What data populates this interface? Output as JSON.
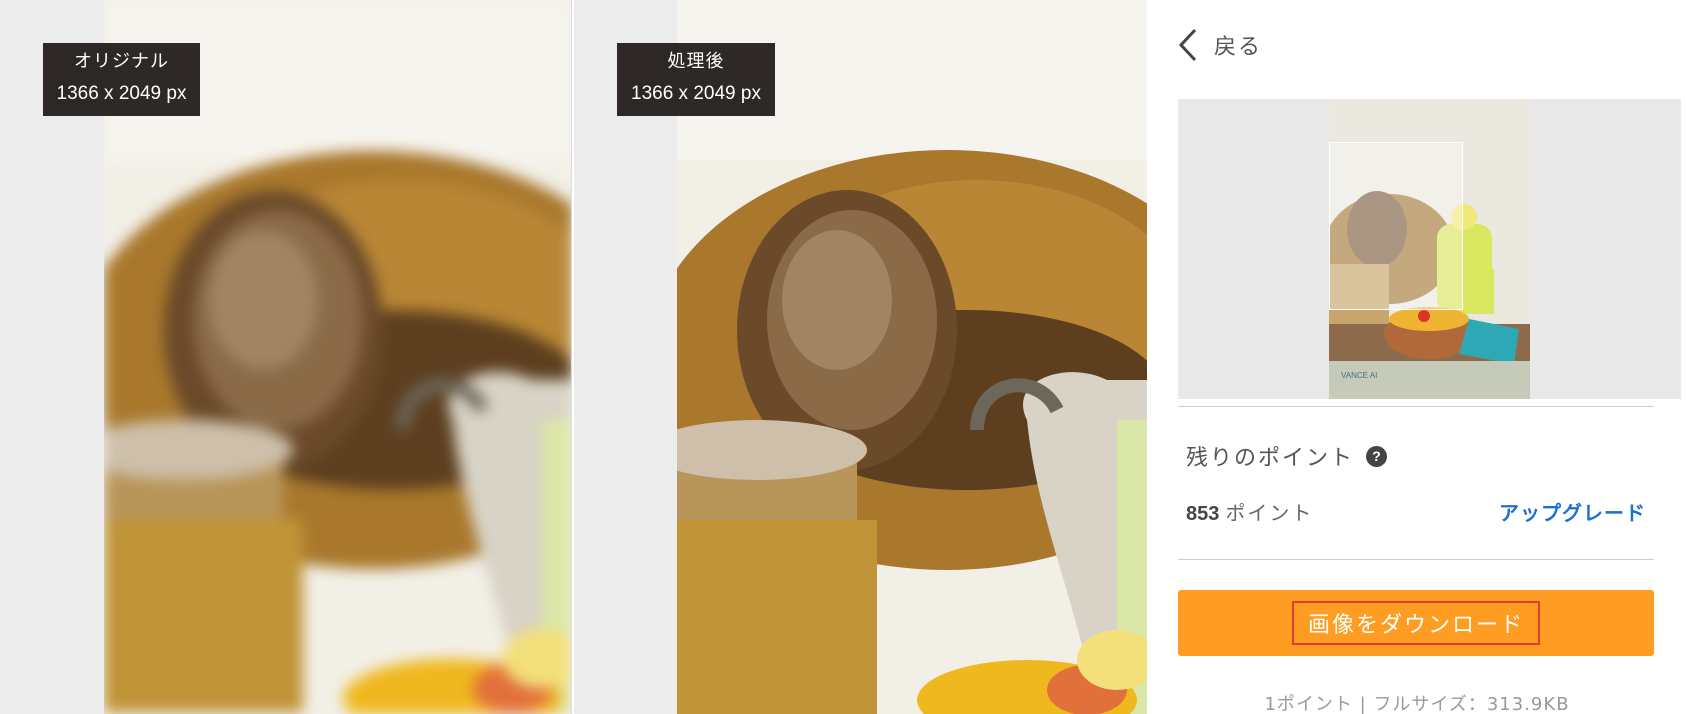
{
  "original": {
    "label": "オリジナル",
    "size": "1366 x 2049 px"
  },
  "processed": {
    "label": "処理後",
    "size": "1366 x 2049 px"
  },
  "sidebar": {
    "back_label": "戻る",
    "thumbnail_watermark": "VANCE AI",
    "points_title": "残りのポイント",
    "help_symbol": "?",
    "points_value": "853",
    "points_unit": "ポイント",
    "upgrade_label": "アップグレード",
    "download_label": "画像をダウンロード",
    "footnote": "1ポイント | フルサイズ：313.9KB"
  },
  "colors": {
    "download_button": "#ff9d22",
    "upgrade_link": "#1b6fd3",
    "badge_background": "#231e1b"
  }
}
